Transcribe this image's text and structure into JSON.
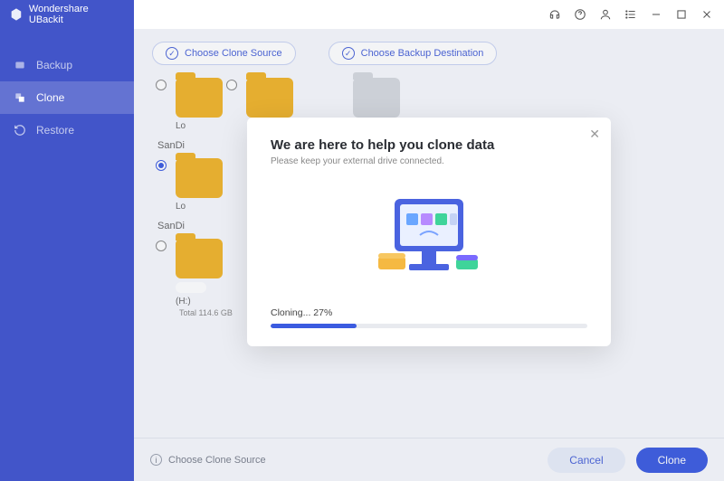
{
  "app": {
    "title": "Wondershare UBackit"
  },
  "titlebar_icons": [
    "headset-icon",
    "help-icon",
    "user-icon",
    "menu-icon",
    "minimize-icon",
    "maximize-icon",
    "close-icon"
  ],
  "sidebar": {
    "items": [
      {
        "label": "Backup",
        "icon": "backup-icon",
        "active": false
      },
      {
        "label": "Clone",
        "icon": "clone-icon",
        "active": true
      },
      {
        "label": "Restore",
        "icon": "restore-icon",
        "active": false
      }
    ]
  },
  "pills": {
    "clone_source": "Choose Clone Source",
    "backup_dest": "Choose Backup Destination"
  },
  "sections": {
    "a": "SanDi",
    "b": "SanDi"
  },
  "disks": {
    "lo": "Lo",
    "hlabel": "(H:)",
    "total": "Total 114.6 GB"
  },
  "footer": {
    "hint": "Choose Clone Source",
    "cancel": "Cancel",
    "clone": "Clone"
  },
  "modal": {
    "title": "We are here to help you clone data",
    "subtitle": "Please keep your external drive connected.",
    "progress_text": "Cloning... 27%",
    "progress_value": 27
  }
}
